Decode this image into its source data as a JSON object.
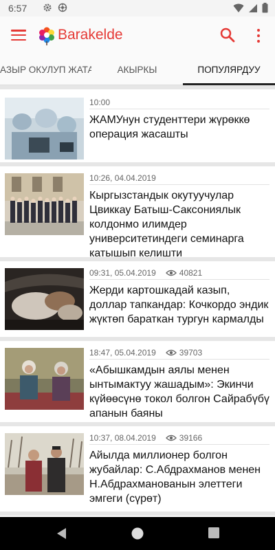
{
  "status_bar": {
    "time": "6:57"
  },
  "app_bar": {
    "brand": "Barakelde"
  },
  "tabs": [
    {
      "label": "АЗЫР ОКУЛУП ЖАТАТ"
    },
    {
      "label": "АКЫРКЫ"
    },
    {
      "label": "ПОПУЛЯРДУУ"
    }
  ],
  "articles": [
    {
      "time": "10:00",
      "views": "",
      "title": "ЖАМУнун студенттери жүрөккө операция жасашты"
    },
    {
      "time": "10:26, 04.04.2019",
      "views": "",
      "title": "Кыргызстандык окутуучулар Цвиккау Батыш-Саксониялык колдонмо илимдер университетиндеги семинарга катышып келишти"
    },
    {
      "time": "09:31, 05.04.2019",
      "views": "40821",
      "title": "Жерди картошкадай казып, доллар тапкандар: Кочкордо эндик жүктөп бараткан тургун кармалды"
    },
    {
      "time": "18:47, 05.04.2019",
      "views": "39703",
      "title": "«Абышкамдын аялы менен ынтымактуу жашадым»: Экинчи күйөөсүнө токол болгон Сайрабүбү апанын баяны"
    },
    {
      "time": "10:37, 08.04.2019",
      "views": "39166",
      "title": "Айылда миллионер болгон жубайлар: С.Абдрахманов менен Н.Абдрахманованын элеттеги эмгеги (сүрөт)"
    }
  ],
  "colors": {
    "accent": "#e53935",
    "text": "#111111",
    "meta": "#666666",
    "background": "#e6e6e6"
  }
}
